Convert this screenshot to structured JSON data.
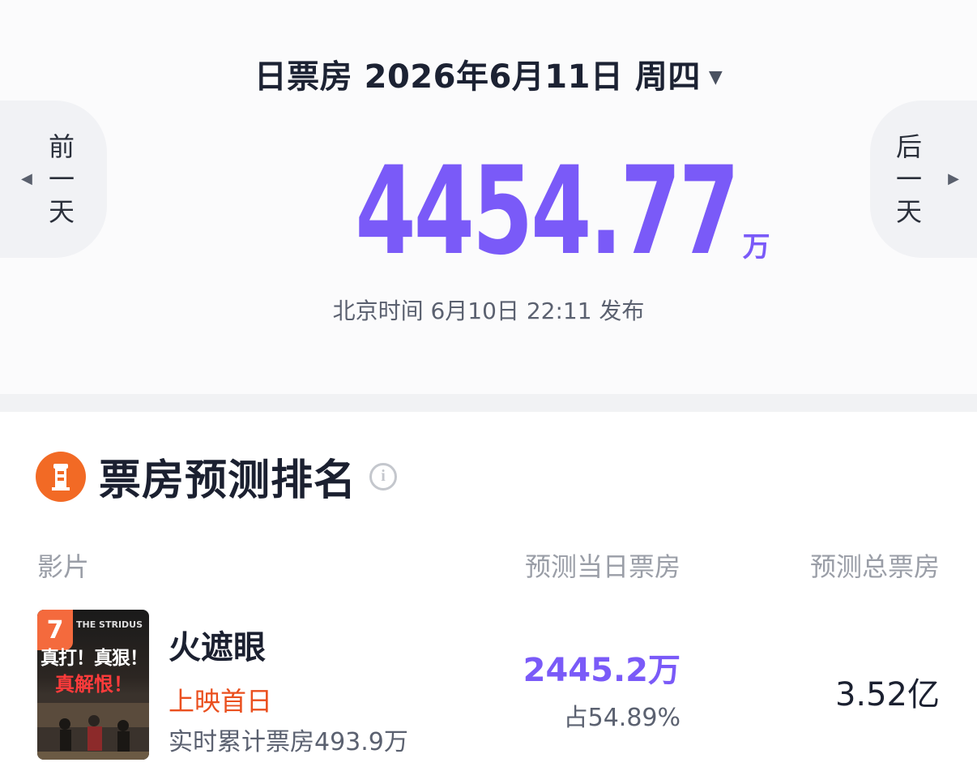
{
  "header": {
    "date_title": "日票房 2026年6月11日 周四",
    "dropdown_caret": "▼"
  },
  "nav": {
    "prev_label": [
      "前",
      "一",
      "天"
    ],
    "next_label": [
      "后",
      "一",
      "天"
    ],
    "prev_arrow": "◀",
    "next_arrow": "▶"
  },
  "summary": {
    "total_value": "4454.77",
    "total_unit": "万",
    "release_text": "北京时间 6月10日 22:11 发布"
  },
  "section": {
    "title": "票房预测排名",
    "info_icon": "i",
    "columns": {
      "film": "影片",
      "day_forecast": "预测当日票房",
      "total_forecast": "预测总票房"
    }
  },
  "films": [
    {
      "rank": "7",
      "poster_title": "THE STRIDUS",
      "poster_slogan_1": "真打！真狠！",
      "poster_slogan_2": "真解恨！",
      "name": "火遮眼",
      "tag": "上映首日",
      "realtime_cumulative": "实时累计票房493.9万",
      "day_forecast": "2445.2万",
      "day_share": "占54.89%",
      "total_forecast": "3.52亿"
    }
  ],
  "colors": {
    "accent_purple": "#7a5af8",
    "accent_orange": "#f26a25",
    "tag_red": "#ea4f1e"
  }
}
